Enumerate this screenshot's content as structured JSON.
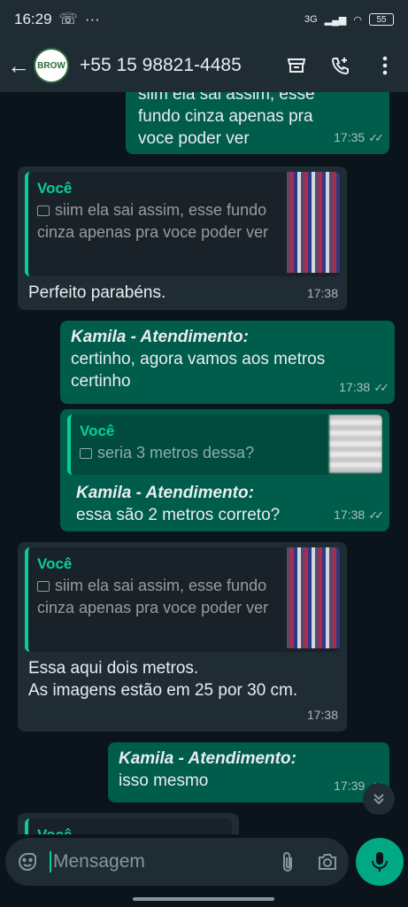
{
  "status": {
    "time": "16:29",
    "network": "3G",
    "battery": "55"
  },
  "header": {
    "contact": "+55 15 98821-4485",
    "avatar_text": "BROW"
  },
  "messages": {
    "m1": {
      "text_line1": "siim ela sai assim, esse",
      "text_line2": "fundo cinza apenas pra",
      "text_line3": "voce poder ver",
      "time": "17:35"
    },
    "m2": {
      "quote_author": "Você",
      "quote_text": "siim ela sai assim, esse fundo cinza apenas pra voce poder ver",
      "text": "Perfeito parabéns.",
      "time": "17:38"
    },
    "m3": {
      "sender": "Kamila - Atendimento:",
      "text": "certinho, agora vamos aos metros certinho",
      "time": "17:38"
    },
    "m4": {
      "quote_author": "Você",
      "quote_text": "seria 3 metros dessa?",
      "sender": "Kamila - Atendimento:",
      "text": "essa são 2 metros correto?",
      "time": "17:38"
    },
    "m5": {
      "quote_author": "Você",
      "quote_text": "siim ela sai assim, esse fundo cinza apenas pra voce poder ver",
      "text_line1": "Essa aqui dois metros.",
      "text_line2": "As imagens estão em 25 por 30 cm.",
      "time": "17:38"
    },
    "m6": {
      "sender": "Kamila - Atendimento:",
      "text": "isso mesmo",
      "time": "17:39"
    },
    "m7": {
      "quote_author": "Você"
    }
  },
  "composer": {
    "placeholder": "Mensagem"
  }
}
